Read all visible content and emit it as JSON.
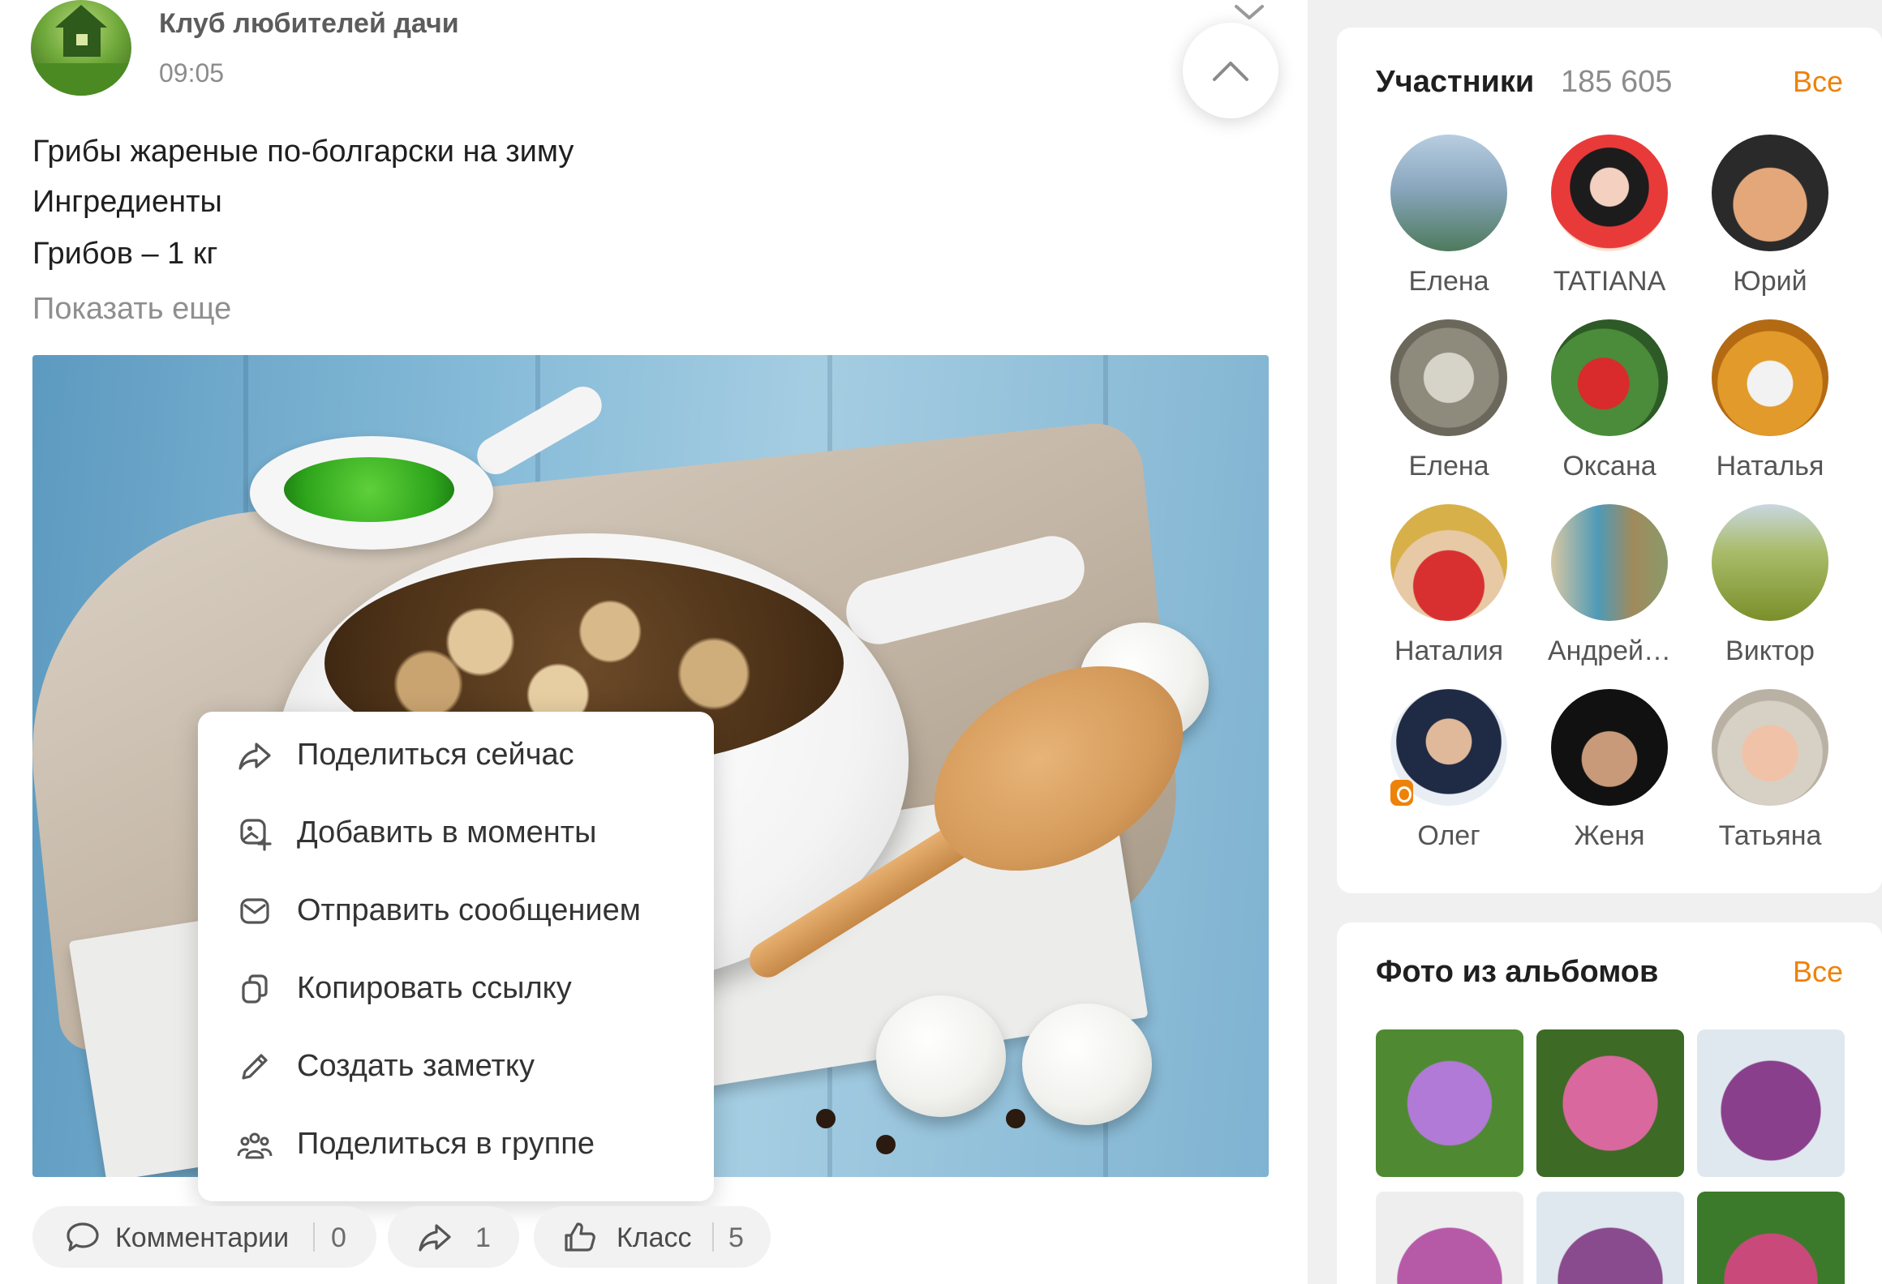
{
  "post": {
    "group_name": "Клуб любителей дачи",
    "time": "09:05",
    "lines": [
      "Грибы жареные по-болгарски на зиму",
      "Ингредиенты",
      "Грибов – 1 кг"
    ],
    "show_more": "Показать еще"
  },
  "share_menu": {
    "items": [
      {
        "label": "Поделиться сейчас",
        "icon": "share-arrow-icon"
      },
      {
        "label": "Добавить в моменты",
        "icon": "moments-add-icon"
      },
      {
        "label": "Отправить сообщением",
        "icon": "envelope-icon"
      },
      {
        "label": "Копировать ссылку",
        "icon": "copy-icon"
      },
      {
        "label": "Создать заметку",
        "icon": "pencil-icon"
      },
      {
        "label": "Поделиться в группе",
        "icon": "group-icon"
      }
    ]
  },
  "actions": {
    "comments_label": "Комментарии",
    "comments_count": "0",
    "share_count": "1",
    "like_label": "Класс",
    "like_count": "5"
  },
  "members": {
    "title": "Участники",
    "count": "185 605",
    "all_link": "Все",
    "list": [
      {
        "name": "Елена"
      },
      {
        "name": "TATIANA"
      },
      {
        "name": "Юрий"
      },
      {
        "name": "Елена"
      },
      {
        "name": "Оксана"
      },
      {
        "name": "Наталья"
      },
      {
        "name": "Наталия"
      },
      {
        "name": "Андрей…"
      },
      {
        "name": "Виктор"
      },
      {
        "name": "Олег"
      },
      {
        "name": "Женя"
      },
      {
        "name": "Татьяна"
      }
    ]
  },
  "photos": {
    "title": "Фото из альбомов",
    "all_link": "Все"
  },
  "colors": {
    "accent": "#ee8208",
    "muted": "#8c8c8c",
    "action_bg": "#f2f2f2"
  }
}
